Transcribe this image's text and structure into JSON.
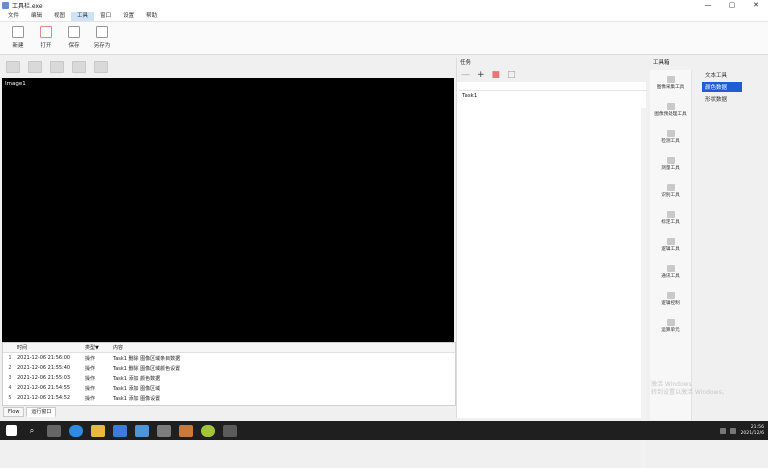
{
  "window": {
    "title": "工具栏.exe",
    "controls": [
      "—",
      "▢",
      "✕"
    ]
  },
  "menu": [
    "文件",
    "编辑",
    "视图",
    "工具",
    "窗口",
    "设置",
    "帮助"
  ],
  "ribbon": [
    {
      "label": "新建",
      "icon": "new-icon"
    },
    {
      "label": "打开",
      "icon": "open-icon"
    },
    {
      "label": "保存",
      "icon": "save-icon"
    },
    {
      "label": "另存为",
      "icon": "save-as-icon"
    }
  ],
  "image_pane": {
    "label": "Image1"
  },
  "log": {
    "columns": [
      "时间",
      "类型",
      "内容"
    ],
    "rows": [
      {
        "idx": "1",
        "time": "2021-12-06 21:56:00",
        "type": "操作",
        "op": "Task1 删除 图像区域条目数据"
      },
      {
        "idx": "2",
        "time": "2021-12-06 21:55:40",
        "type": "操作",
        "op": "Task1 删除 图像区域颜色设置"
      },
      {
        "idx": "3",
        "time": "2021-12-06 21:55:03",
        "type": "操作",
        "op": "Task1 添加 颜色数据"
      },
      {
        "idx": "4",
        "time": "2021-12-06 21:54:55",
        "type": "操作",
        "op": "Task1 添加 图像区域"
      },
      {
        "idx": "5",
        "time": "2021-12-06 21:54:52",
        "type": "操作",
        "op": "Task1 添加 图像设置"
      }
    ]
  },
  "bottom_tabs": [
    "Flow",
    "运行窗口"
  ],
  "task_panel": {
    "header": "任务",
    "node": "Task1"
  },
  "tools_panel": {
    "header": "工具箱",
    "tools": [
      "图像采集工具",
      "图像预处理工具",
      "检测工具",
      "测量工具",
      "识别工具",
      "标定工具",
      "逻辑工具",
      "通讯工具",
      "逻辑控制",
      "运算单元"
    ],
    "sub_items": [
      "文本工具",
      "颜色数据",
      "形状数据"
    ],
    "selected_sub": 1
  },
  "watermark": [
    "激活 Windows",
    "转到设置以激活 Windows。"
  ],
  "taskbar": {
    "time": "21:56",
    "date": "2021/12/6"
  }
}
